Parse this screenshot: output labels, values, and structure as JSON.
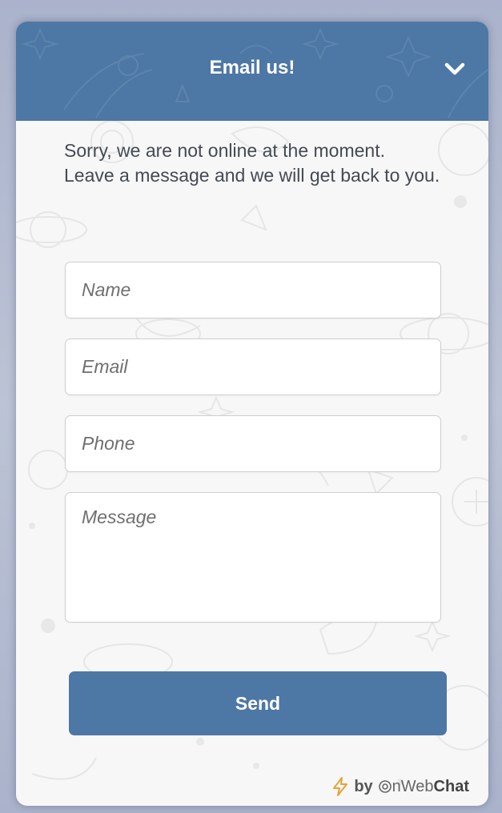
{
  "header": {
    "title": "Email us!",
    "collapse_icon": "chevron-down-icon",
    "background_color": "#4d77a4"
  },
  "intro_text": "Sorry, we are not online at the moment. Leave a message and we will get back to you.",
  "form": {
    "name_placeholder": "Name",
    "email_placeholder": "Email",
    "phone_placeholder": "Phone",
    "message_placeholder": "Message",
    "name_value": "",
    "email_value": "",
    "phone_value": "",
    "message_value": "",
    "send_label": "Send"
  },
  "footer": {
    "bolt_icon": "lightning-bolt-icon",
    "by_label": "by",
    "brand_light": "nWeb",
    "brand_bold": "Chat",
    "brand_logo_icon": "at-sign-logo-icon"
  },
  "colors": {
    "accent": "#4d77a4",
    "panel_background": "#f7f7f7",
    "text": "#444a52"
  }
}
